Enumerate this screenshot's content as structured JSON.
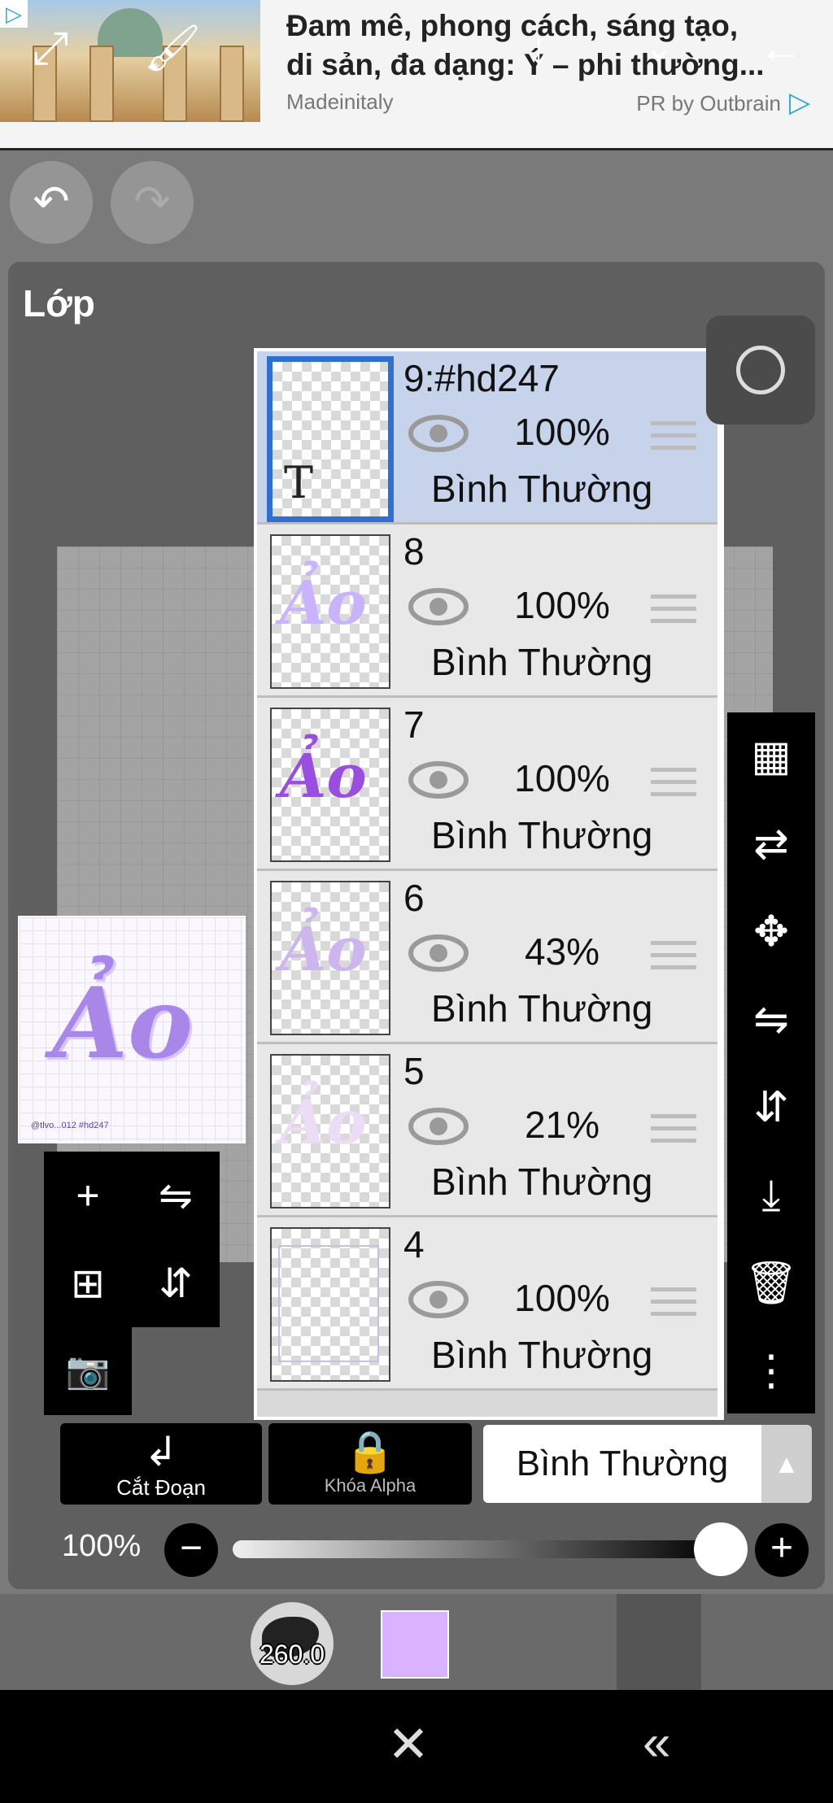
{
  "ad": {
    "title_line1": "Đam mê, phong cách, sáng tạo,",
    "title_line2": "di sản, đa dạng: Ý – phi thường...",
    "source": "Madeinitaly",
    "by": "PR by Outbrain"
  },
  "panel": {
    "title": "Lớp"
  },
  "thumbnail": {
    "art_text": "Ảo",
    "credit": "@tlvo...012 #hd247"
  },
  "layers": [
    {
      "name": "9:#hd247",
      "opacity": "100%",
      "mode": "Bình Thường",
      "selected": true,
      "thumb": "T"
    },
    {
      "name": "8",
      "opacity": "100%",
      "mode": "Bình Thường",
      "selected": false,
      "thumb": "Ảo"
    },
    {
      "name": "7",
      "opacity": "100%",
      "mode": "Bình Thường",
      "selected": false,
      "thumb": "Ảo"
    },
    {
      "name": "6",
      "opacity": "43%",
      "mode": "Bình Thường",
      "selected": false,
      "thumb": "Ảo"
    },
    {
      "name": "5",
      "opacity": "21%",
      "mode": "Bình Thường",
      "selected": false,
      "thumb": "Ảo"
    },
    {
      "name": "4",
      "opacity": "100%",
      "mode": "Bình Thường",
      "selected": false,
      "thumb": ""
    }
  ],
  "buttons": {
    "clipping": "Cắt Đoạn",
    "alpha_lock": "Khóa Alpha",
    "blend_mode": "Bình Thường"
  },
  "opacity": {
    "label": "100%",
    "value": 1.0
  },
  "toolbar": {
    "brush_size": "260.0",
    "color": "#d9b3ff"
  },
  "colors": {
    "selected_row": "#c6d3eb",
    "row": "#e8e8e8",
    "accent": "#2f6fd1"
  }
}
